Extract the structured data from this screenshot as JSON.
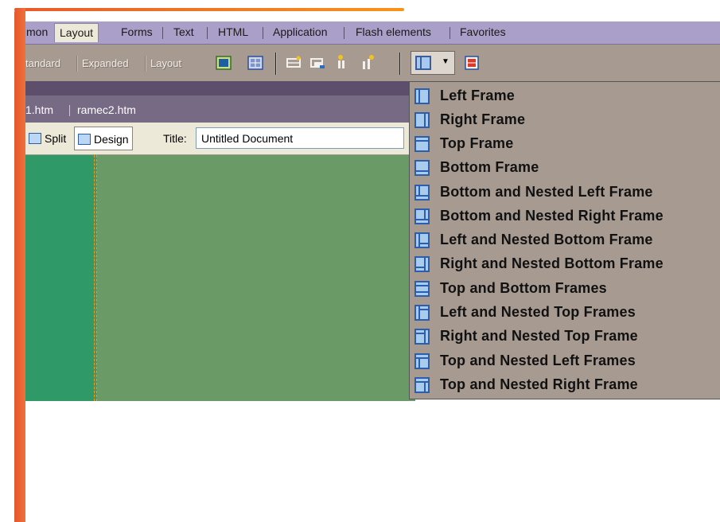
{
  "insert_bar": {
    "tabs": [
      "mon",
      "Layout",
      "Forms",
      "Text",
      "HTML",
      "Application",
      "Flash elements",
      "Favorites"
    ]
  },
  "toolbar": {
    "modes": [
      "tandard",
      "Expanded",
      "Layout"
    ],
    "icons": [
      "table-icon",
      "layer-icon",
      "layout-table-icon",
      "layout-cell-icon",
      "div-icon",
      "frame-tag-icon",
      "frames-icon",
      "chevron-down-icon",
      "tabular-data-icon"
    ]
  },
  "documents": {
    "files": [
      "1.htm",
      "ramec2.htm"
    ]
  },
  "view_bar": {
    "split_label": "Split",
    "design_label": "Design",
    "title_label": "Title:",
    "title_value": "Untitled Document"
  },
  "frames_menu": {
    "items": [
      "Left Frame",
      "Right Frame",
      "Top Frame",
      "Bottom Frame",
      "Bottom and Nested Left Frame",
      "Bottom and Nested Right Frame",
      "Left and Nested Bottom Frame",
      "Right and Nested Bottom Frame",
      "Top and Bottom Frames",
      "Left and Nested Top Frames",
      "Right and Nested Top Frame",
      "Top and Nested Left Frames",
      "Top and Nested Right Frame"
    ]
  },
  "colors": {
    "accent_orange": "#f07a35",
    "tab_strip": "#a99fc9",
    "toolbar": "#a69a91",
    "canvas_left": "#2f9a67",
    "canvas_right": "#6a9a66"
  }
}
